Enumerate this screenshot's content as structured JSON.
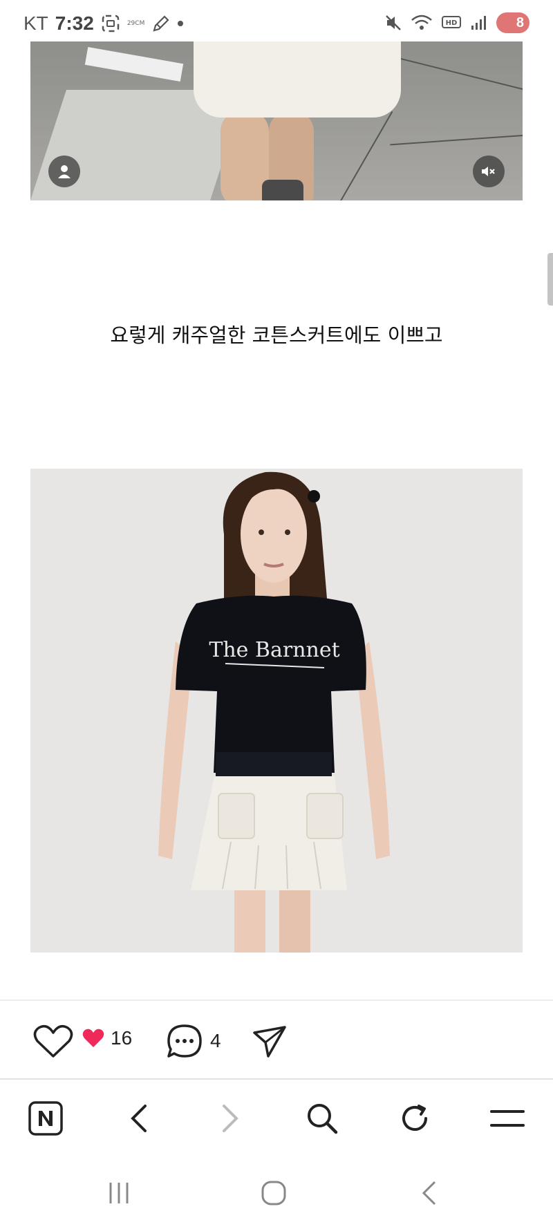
{
  "status_bar": {
    "carrier": "KT",
    "time": "7:32",
    "temperature": "29CM",
    "battery": "8",
    "battery_color": "#e07575"
  },
  "post": {
    "caption": "요렇게 캐주얼한 코튼스커트에도 이쁘고",
    "image_text": "The Barnnet",
    "likes_count": "16",
    "comments_count": "4",
    "like_color": "#ef2a5a"
  },
  "icons": {
    "profile": "person-icon",
    "mute": "mute-icon",
    "like": "heart-outline-icon",
    "likes": "heart-filled-icon",
    "comment": "chat-bubble-icon",
    "share": "paper-plane-icon",
    "naver": "naver-n-icon",
    "back": "chevron-left-icon",
    "forward": "chevron-right-icon",
    "search": "search-icon",
    "refresh": "refresh-icon",
    "menu": "hamburger-menu-icon"
  }
}
